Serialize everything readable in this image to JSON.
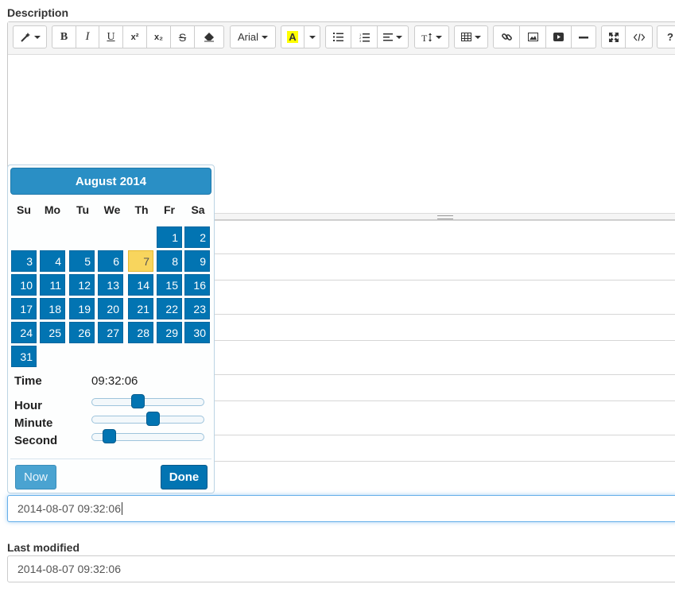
{
  "description_label": "Description",
  "toolbar": {
    "font_name": "Arial",
    "bold": "B",
    "italic": "I",
    "underline": "U",
    "superscript": "x²",
    "subscript": "x₂",
    "strikethrough": "S",
    "help": "?",
    "highlight_letter": "A",
    "highlight_color": "#ffff00",
    "icons": [
      "magic-wand-icon",
      "eraser-icon",
      "unordered-list-icon",
      "ordered-list-icon",
      "align-icon",
      "text-height-icon",
      "table-icon",
      "link-icon",
      "picture-icon",
      "video-icon",
      "horizontal-rule-icon",
      "fullscreen-icon",
      "code-view-icon"
    ]
  },
  "datepicker": {
    "month_title": "August 2014",
    "weekdays": [
      "Su",
      "Mo",
      "Tu",
      "We",
      "Th",
      "Fr",
      "Sa"
    ],
    "days": [
      "1",
      "2",
      "3",
      "4",
      "5",
      "6",
      "7",
      "8",
      "9",
      "10",
      "11",
      "12",
      "13",
      "14",
      "15",
      "16",
      "17",
      "18",
      "19",
      "20",
      "21",
      "22",
      "23",
      "24",
      "25",
      "26",
      "27",
      "28",
      "29",
      "30",
      "31"
    ],
    "today": "7",
    "time_label": "Time",
    "time_value": "09:32:06",
    "hour_label": "Hour",
    "minute_label": "Minute",
    "second_label": "Second",
    "hour_value": 9,
    "minute_value": 32,
    "second_value": 6,
    "now_button": "Now",
    "done_button": "Done",
    "header_color": "#2a8fc5",
    "day_color": "#0274b2",
    "today_color": "#f8d55d"
  },
  "date_input_value": "2014-08-07 09:32:06",
  "last_modified_label": "Last modified",
  "last_modified_value": "2014-08-07 09:32:06"
}
